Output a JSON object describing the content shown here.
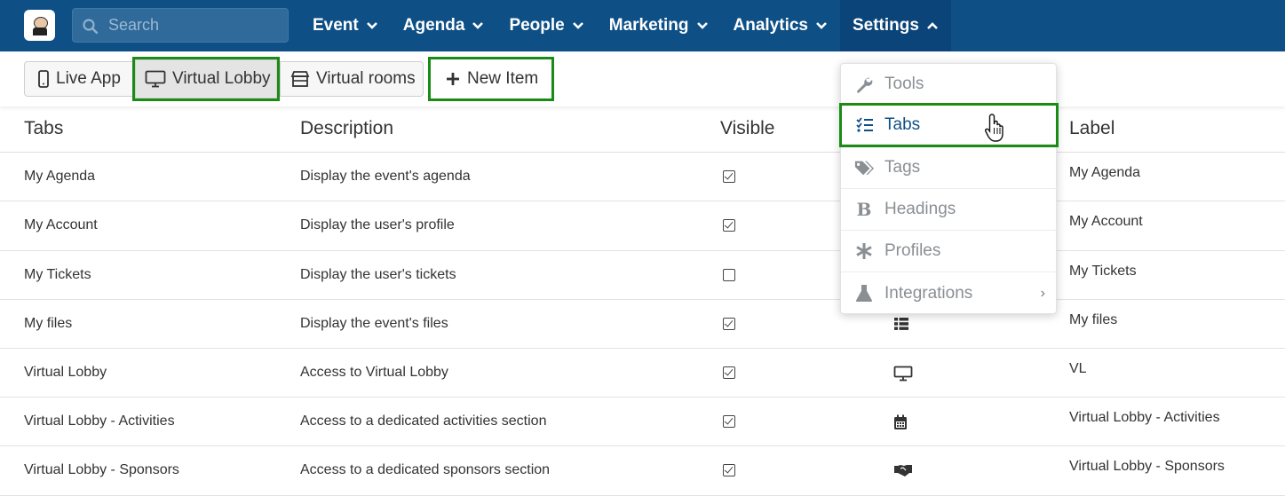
{
  "header": {
    "search_placeholder": "Search",
    "nav": [
      {
        "label": "Event"
      },
      {
        "label": "Agenda"
      },
      {
        "label": "People"
      },
      {
        "label": "Marketing"
      },
      {
        "label": "Analytics"
      },
      {
        "label": "Settings"
      }
    ]
  },
  "toolbar": {
    "live_app": "Live App",
    "virtual_lobby": "Virtual Lobby",
    "virtual_rooms": "Virtual rooms",
    "new_item": "New Item"
  },
  "table": {
    "headers": {
      "tabs": "Tabs",
      "description": "Description",
      "visible": "Visible",
      "label": "Label"
    },
    "rows": [
      {
        "tab": "My Agenda",
        "description": "Display the event's agenda",
        "visible": true,
        "icon": "calendar-icon",
        "label": "My Agenda"
      },
      {
        "tab": "My Account",
        "description": "Display the user's profile",
        "visible": true,
        "icon": "user-icon",
        "label": "My Account"
      },
      {
        "tab": "My Tickets",
        "description": "Display the user's tickets",
        "visible": false,
        "icon": "ticket-icon",
        "label": "My Tickets"
      },
      {
        "tab": "My files",
        "description": "Display the event's files",
        "visible": true,
        "icon": "list-icon",
        "label": "My files"
      },
      {
        "tab": "Virtual Lobby",
        "description": "Access to Virtual Lobby",
        "visible": true,
        "icon": "desktop-icon",
        "label": "VL"
      },
      {
        "tab": "Virtual Lobby - Activities",
        "description": "Access to a dedicated activities section",
        "visible": true,
        "icon": "calendar-icon",
        "label": "Virtual Lobby - Activities"
      },
      {
        "tab": "Virtual Lobby - Sponsors",
        "description": "Access to a dedicated sponsors section",
        "visible": true,
        "icon": "handshake-icon",
        "label": "Virtual Lobby - Sponsors"
      }
    ]
  },
  "settings_menu": {
    "items": [
      {
        "label": "Tools",
        "icon": "wrench-icon"
      },
      {
        "label": "Tabs",
        "icon": "tasks-list-icon",
        "selected": true
      },
      {
        "label": "Tags",
        "icon": "tags-icon"
      },
      {
        "label": "Headings",
        "icon": "bold-icon"
      },
      {
        "label": "Profiles",
        "icon": "asterisk-icon"
      },
      {
        "label": "Integrations",
        "icon": "flask-icon",
        "submenu": true
      }
    ]
  },
  "colors": {
    "topbar": "#0e4f86",
    "highlight": "#1a8c16"
  }
}
